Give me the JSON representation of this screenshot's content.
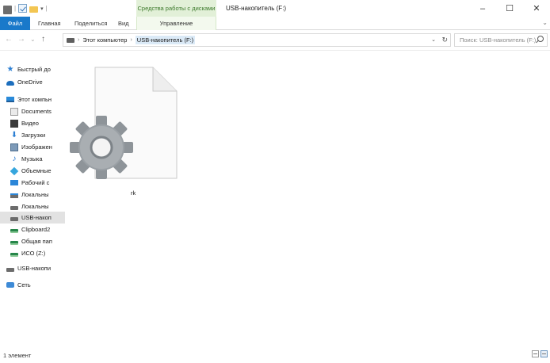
{
  "window": {
    "title": "USB-накопитель (F:)",
    "context_tab_group": "Средства работы с дисками",
    "minimize_glyph": "–",
    "maximize_glyph": "☐",
    "close_glyph": "✕"
  },
  "quick_access": {
    "dropdown_glyph": "▾",
    "separator": "|"
  },
  "ribbon": {
    "tabs": [
      "Файл",
      "Главная",
      "Поделиться",
      "Вид",
      "Управление"
    ],
    "expand_glyph": "⌄"
  },
  "navigation": {
    "back_glyph": "←",
    "forward_glyph": "→",
    "recent_glyph": "⌄",
    "up_glyph": "↑",
    "breadcrumb": [
      "Этот компьютер",
      "USB-накопитель (F:)"
    ],
    "crumb_separator": "›",
    "address_dropdown_glyph": "⌄",
    "refresh_glyph": "↻",
    "search_placeholder": "Поиск: USB-накопитель (F:)"
  },
  "sidebar": {
    "items": [
      {
        "label": "Быстрый до",
        "icon": "star-icon"
      },
      {
        "label": "OneDrive",
        "icon": "cloud-icon"
      },
      {
        "label": "Этот компьн",
        "icon": "computer-icon"
      },
      {
        "label": "Documents",
        "icon": "document-folder-icon"
      },
      {
        "label": "Видео",
        "icon": "video-folder-icon"
      },
      {
        "label": "Загрузки",
        "icon": "downloads-icon"
      },
      {
        "label": "Изображен",
        "icon": "pictures-icon"
      },
      {
        "label": "Музыка",
        "icon": "music-icon"
      },
      {
        "label": "Объемные",
        "icon": "3d-objects-icon"
      },
      {
        "label": "Рабочий с",
        "icon": "desktop-icon"
      },
      {
        "label": "Локальны",
        "icon": "system-drive-icon"
      },
      {
        "label": "Локальны",
        "icon": "drive-icon"
      },
      {
        "label": "USB-накоп",
        "icon": "usb-drive-icon",
        "selected": true
      },
      {
        "label": "Clipboard2",
        "icon": "network-drive-icon"
      },
      {
        "label": "Общая пап",
        "icon": "network-drive-icon"
      },
      {
        "label": "ИСО (Z:)",
        "icon": "network-drive-icon"
      },
      {
        "label": "USB-накопи",
        "icon": "usb-drive-icon"
      },
      {
        "label": "Сеть",
        "icon": "network-icon"
      }
    ]
  },
  "content": {
    "files": [
      {
        "name": "rk",
        "icon": "system-file-gear-icon"
      }
    ]
  },
  "status": {
    "item_count": "1 элемент"
  },
  "colors": {
    "file_tab": "#1979ca",
    "context_tab": "#e2f0d8",
    "selection": "#e2e2e2",
    "breadcrumb_highlight": "#dbeaf7"
  }
}
